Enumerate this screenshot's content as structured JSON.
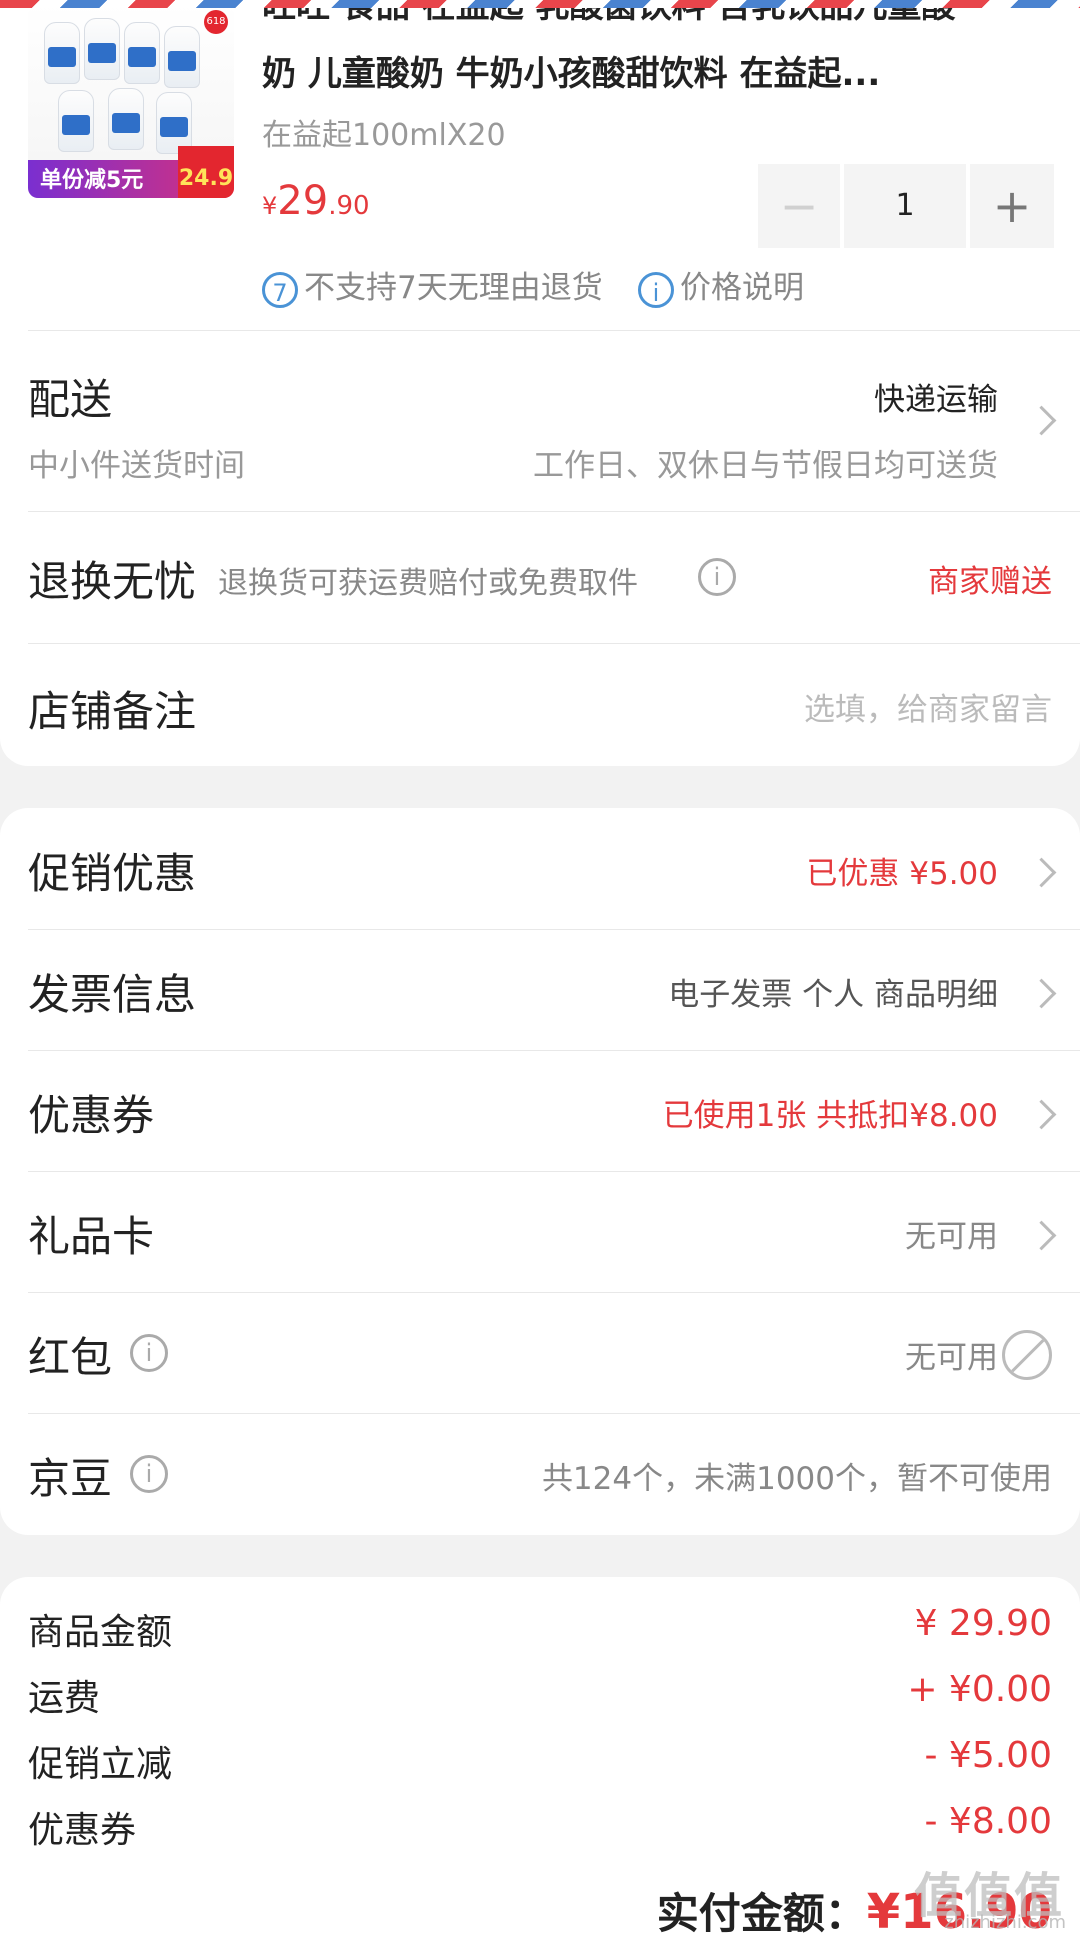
{
  "product": {
    "title_line1": "旺旺 食品 在益起 乳酸菌饮料 含乳饮品儿童酸",
    "title_line2": "奶 儿童酸奶 牛奶小孩酸甜饮料 在益起...",
    "spec": "在益起100mlX20",
    "price_currency": "¥",
    "price_int": "29",
    "price_dec": ".90",
    "quantity": "1",
    "image_promo_text": "单份减5元",
    "image_promo_price": "24.9",
    "image_badge": "618",
    "notice_return": "不支持7天无理由退货",
    "notice_price": "价格说明"
  },
  "delivery": {
    "label": "配送",
    "method": "快递运输",
    "time_label": "中小件送货时间",
    "time_value": "工作日、双休日与节假日均可送货"
  },
  "return": {
    "label": "退换无忧",
    "desc": "退换货可获运费赔付或免费取件",
    "value": "商家赠送"
  },
  "remark": {
    "label": "店铺备注",
    "placeholder": "选填，给商家留言"
  },
  "options": {
    "promotion": {
      "label": "促销优惠",
      "value": "已优惠 ¥5.00"
    },
    "invoice": {
      "label": "发票信息",
      "value": "电子发票 个人 商品明细"
    },
    "coupon": {
      "label": "优惠券",
      "value": "已使用1张 共抵扣¥8.00"
    },
    "giftcard": {
      "label": "礼品卡",
      "value": "无可用"
    },
    "redpacket": {
      "label": "红包",
      "value": "无可用"
    },
    "jingdou": {
      "label": "京豆",
      "value": "共124个，未满1000个，暂不可使用"
    }
  },
  "summary": {
    "goods_label": "商品金额",
    "goods_value": "¥ 29.90",
    "freight_label": "运费",
    "freight_value": "+ ¥0.00",
    "promo_label": "促销立减",
    "promo_value": "- ¥5.00",
    "coupon_label": "优惠券",
    "coupon_value": "- ¥8.00",
    "total_label": "实付金额：",
    "total_value": "¥16.90"
  },
  "watermark": {
    "text": "值值值",
    "url": "zhizhizhi.com"
  },
  "colors": {
    "accent": "#e4393c",
    "info_blue": "#4a93d6",
    "background": "#f2f2f2"
  }
}
